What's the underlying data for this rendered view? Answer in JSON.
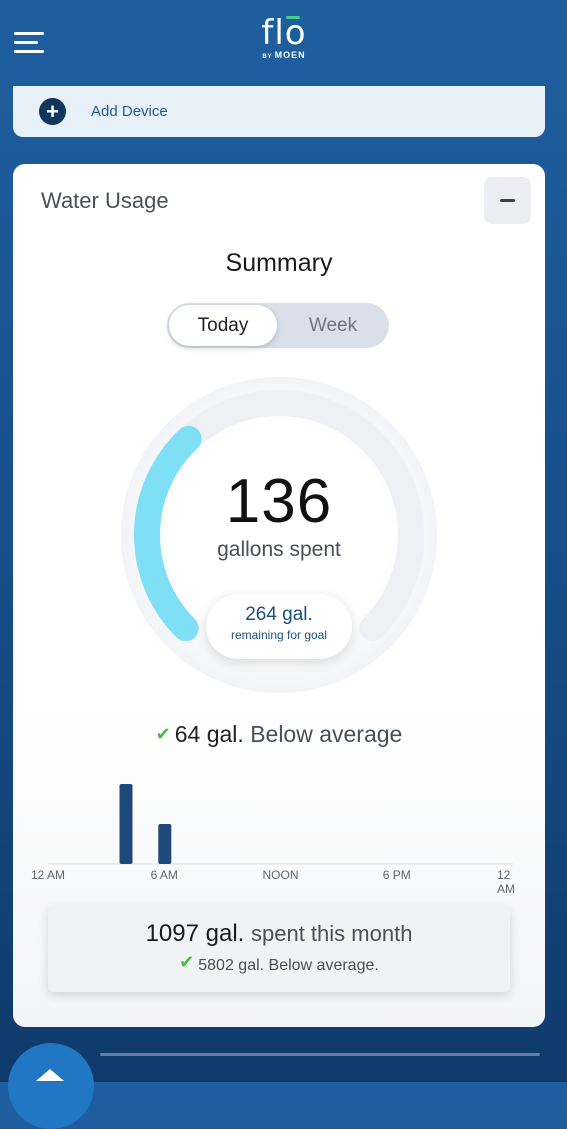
{
  "header": {
    "logo_main": "flo",
    "logo_by": "BY",
    "logo_brand": "MOEN"
  },
  "add_device": {
    "label": "Add Device"
  },
  "water_usage": {
    "title": "Water Usage",
    "summary_title": "Summary",
    "tabs": {
      "today": "Today",
      "week": "Week",
      "selected": "Today"
    },
    "gallons_spent": "136",
    "gallons_label": "gallons spent",
    "remaining_value": "264 gal.",
    "remaining_label": "remaining for goal",
    "goal_progress": 0.34,
    "comparison_value": "64 gal.",
    "comparison_text": "Below average",
    "month_value": "1097 gal.",
    "month_text": "spent this month",
    "month_comparison": "5802 gal. Below average."
  },
  "chart_data": {
    "type": "bar",
    "x_ticks": [
      "12 AM",
      "6 AM",
      "NOON",
      "6 PM",
      "12 AM"
    ],
    "x": [
      4,
      6
    ],
    "values": [
      80,
      40
    ],
    "xlim": [
      0,
      24
    ],
    "grid": false,
    "colors": {
      "bar": "#1d4a7a"
    }
  },
  "colors": {
    "accent": "#1f5fa0",
    "gauge": "#7fe0f5",
    "positive": "#4cb848"
  }
}
